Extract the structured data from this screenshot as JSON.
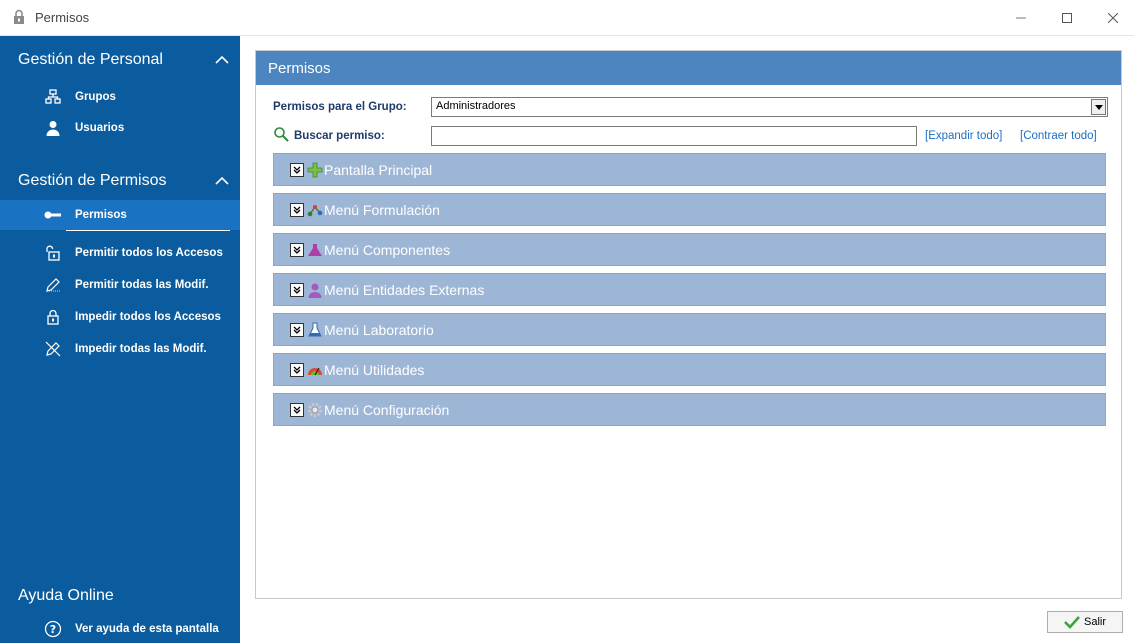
{
  "window": {
    "title": "Permisos",
    "minimize_icon": "minimize-icon",
    "maximize_icon": "maximize-icon",
    "close_icon": "close-icon"
  },
  "sidebar": {
    "sections": [
      {
        "header": "Gestión de Personal",
        "items": [
          {
            "label": "Grupos",
            "icon": "groups-icon"
          },
          {
            "label": "Usuarios",
            "icon": "user-icon"
          }
        ]
      },
      {
        "header": "Gestión de Permisos",
        "items": [
          {
            "label": "Permisos",
            "icon": "key-icon",
            "active": true
          },
          {
            "label": "Permitir todos los Accesos",
            "icon": "unlock-icon"
          },
          {
            "label": "Permitir todas las Modif.",
            "icon": "pencil-icon"
          },
          {
            "label": "Impedir todos los Accesos",
            "icon": "lock-icon"
          },
          {
            "label": "Impedir todas las Modif.",
            "icon": "no-edit-icon"
          }
        ]
      }
    ],
    "help": {
      "header": "Ayuda Online",
      "item": {
        "label": "Ver ayuda de esta pantalla",
        "icon": "help-circle-icon"
      }
    }
  },
  "main": {
    "title": "Permisos",
    "group_label": "Permisos para el Grupo:",
    "group_value": "Administradores",
    "search_label": "Buscar permiso:",
    "search_value": "",
    "expand_all": "[Expandir todo]",
    "collapse_all": "[Contraer todo]",
    "groups": [
      {
        "label": "Pantalla Principal",
        "icon": "green-plus-icon"
      },
      {
        "label": "Menú Formulación",
        "icon": "molecule-icon"
      },
      {
        "label": "Menú Componentes",
        "icon": "flask-icon"
      },
      {
        "label": "Menú Entidades Externas",
        "icon": "person-icon"
      },
      {
        "label": "Menú Laboratorio",
        "icon": "lab-beaker-icon"
      },
      {
        "label": "Menú Utilidades",
        "icon": "gauge-icon"
      },
      {
        "label": "Menú Configuración",
        "icon": "gear-icon"
      }
    ]
  },
  "footer": {
    "exit_label": "Salir"
  },
  "colors": {
    "sidebar_bg": "#0a5c9e",
    "sidebar_active": "#1a73c2",
    "panel_header": "#4c85bf",
    "group_bar": "#9db6d6",
    "link": "#1d6fc2"
  }
}
